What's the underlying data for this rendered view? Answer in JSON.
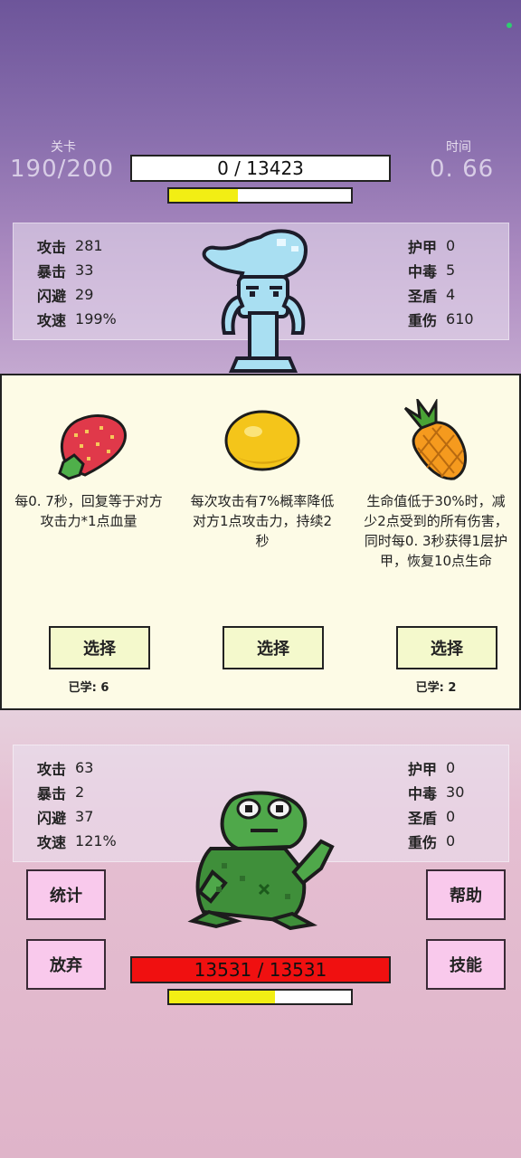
{
  "header": {
    "level_label": "关卡",
    "level_value": "190/200",
    "time_label": "时间",
    "time_value": "0. 66"
  },
  "enemy": {
    "hp_text": "0  /  13423",
    "hp_fraction": 0,
    "energy_fraction": 0.38,
    "stats_left": [
      {
        "label": "攻击",
        "value": "281"
      },
      {
        "label": "暴击",
        "value": "33"
      },
      {
        "label": "闪避",
        "value": "29"
      },
      {
        "label": "攻速",
        "value": "199%"
      }
    ],
    "stats_right": [
      {
        "label": "护甲",
        "value": "0"
      },
      {
        "label": "中毒",
        "value": "5"
      },
      {
        "label": "圣盾",
        "value": "4"
      },
      {
        "label": "重伤",
        "value": "610"
      }
    ],
    "sprite_icon": "squid-creature-icon"
  },
  "choices": [
    {
      "icon": "strawberry-icon",
      "desc": "每0. 7秒，回复等于对方攻击力*1点血量",
      "button": "选择",
      "learned": "已学: 6"
    },
    {
      "icon": "lemon-icon",
      "desc": "每次攻击有7%概率降低对方1点攻击力，持续2秒",
      "button": "选择",
      "learned": ""
    },
    {
      "icon": "pineapple-icon",
      "desc": "生命值低于30%时，减少2点受到的所有伤害，同时每0. 3秒获得1层护甲，恢复10点生命",
      "button": "选择",
      "learned": "已学: 2"
    }
  ],
  "player": {
    "hp_text": "13531  /  13531",
    "hp_fraction": 1,
    "energy_fraction": 0.58,
    "stats_left": [
      {
        "label": "攻击",
        "value": "63"
      },
      {
        "label": "暴击",
        "value": "2"
      },
      {
        "label": "闪避",
        "value": "37"
      },
      {
        "label": "攻速",
        "value": "121%"
      }
    ],
    "stats_right": [
      {
        "label": "护甲",
        "value": "0"
      },
      {
        "label": "中毒",
        "value": "30"
      },
      {
        "label": "圣盾",
        "value": "0"
      },
      {
        "label": "重伤",
        "value": "0"
      }
    ],
    "sprite_icon": "frog-icon"
  },
  "buttons": {
    "stats": "统计",
    "help": "帮助",
    "give_up": "放弃",
    "skills": "技能"
  },
  "colors": {
    "player_hp": "#f01010",
    "energy": "#f2ee14",
    "side_button": "#f9c9ec",
    "choice_button": "#f4f9cc"
  }
}
